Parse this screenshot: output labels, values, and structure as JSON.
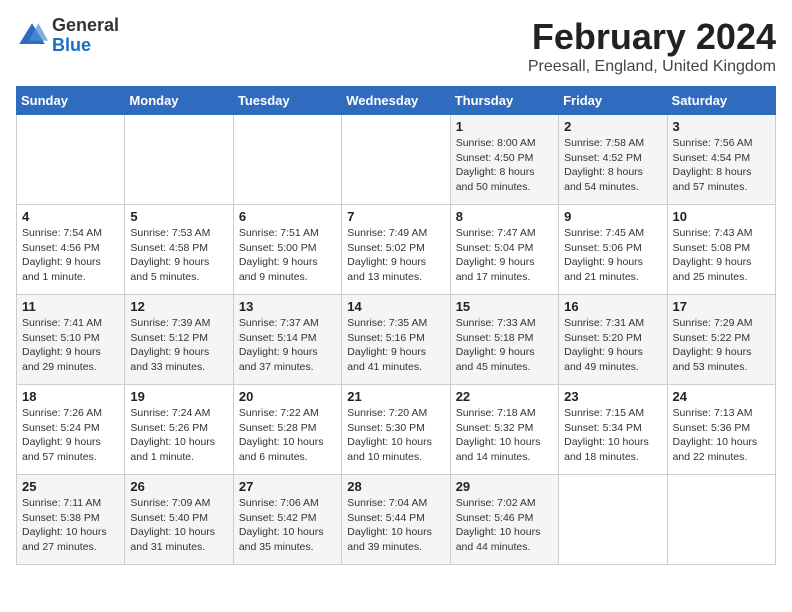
{
  "header": {
    "logo_general": "General",
    "logo_blue": "Blue",
    "title": "February 2024",
    "subtitle": "Preesall, England, United Kingdom"
  },
  "days_of_week": [
    "Sunday",
    "Monday",
    "Tuesday",
    "Wednesday",
    "Thursday",
    "Friday",
    "Saturday"
  ],
  "weeks": [
    [
      {
        "num": "",
        "info": ""
      },
      {
        "num": "",
        "info": ""
      },
      {
        "num": "",
        "info": ""
      },
      {
        "num": "",
        "info": ""
      },
      {
        "num": "1",
        "info": "Sunrise: 8:00 AM\nSunset: 4:50 PM\nDaylight: 8 hours\nand 50 minutes."
      },
      {
        "num": "2",
        "info": "Sunrise: 7:58 AM\nSunset: 4:52 PM\nDaylight: 8 hours\nand 54 minutes."
      },
      {
        "num": "3",
        "info": "Sunrise: 7:56 AM\nSunset: 4:54 PM\nDaylight: 8 hours\nand 57 minutes."
      }
    ],
    [
      {
        "num": "4",
        "info": "Sunrise: 7:54 AM\nSunset: 4:56 PM\nDaylight: 9 hours\nand 1 minute."
      },
      {
        "num": "5",
        "info": "Sunrise: 7:53 AM\nSunset: 4:58 PM\nDaylight: 9 hours\nand 5 minutes."
      },
      {
        "num": "6",
        "info": "Sunrise: 7:51 AM\nSunset: 5:00 PM\nDaylight: 9 hours\nand 9 minutes."
      },
      {
        "num": "7",
        "info": "Sunrise: 7:49 AM\nSunset: 5:02 PM\nDaylight: 9 hours\nand 13 minutes."
      },
      {
        "num": "8",
        "info": "Sunrise: 7:47 AM\nSunset: 5:04 PM\nDaylight: 9 hours\nand 17 minutes."
      },
      {
        "num": "9",
        "info": "Sunrise: 7:45 AM\nSunset: 5:06 PM\nDaylight: 9 hours\nand 21 minutes."
      },
      {
        "num": "10",
        "info": "Sunrise: 7:43 AM\nSunset: 5:08 PM\nDaylight: 9 hours\nand 25 minutes."
      }
    ],
    [
      {
        "num": "11",
        "info": "Sunrise: 7:41 AM\nSunset: 5:10 PM\nDaylight: 9 hours\nand 29 minutes."
      },
      {
        "num": "12",
        "info": "Sunrise: 7:39 AM\nSunset: 5:12 PM\nDaylight: 9 hours\nand 33 minutes."
      },
      {
        "num": "13",
        "info": "Sunrise: 7:37 AM\nSunset: 5:14 PM\nDaylight: 9 hours\nand 37 minutes."
      },
      {
        "num": "14",
        "info": "Sunrise: 7:35 AM\nSunset: 5:16 PM\nDaylight: 9 hours\nand 41 minutes."
      },
      {
        "num": "15",
        "info": "Sunrise: 7:33 AM\nSunset: 5:18 PM\nDaylight: 9 hours\nand 45 minutes."
      },
      {
        "num": "16",
        "info": "Sunrise: 7:31 AM\nSunset: 5:20 PM\nDaylight: 9 hours\nand 49 minutes."
      },
      {
        "num": "17",
        "info": "Sunrise: 7:29 AM\nSunset: 5:22 PM\nDaylight: 9 hours\nand 53 minutes."
      }
    ],
    [
      {
        "num": "18",
        "info": "Sunrise: 7:26 AM\nSunset: 5:24 PM\nDaylight: 9 hours\nand 57 minutes."
      },
      {
        "num": "19",
        "info": "Sunrise: 7:24 AM\nSunset: 5:26 PM\nDaylight: 10 hours\nand 1 minute."
      },
      {
        "num": "20",
        "info": "Sunrise: 7:22 AM\nSunset: 5:28 PM\nDaylight: 10 hours\nand 6 minutes."
      },
      {
        "num": "21",
        "info": "Sunrise: 7:20 AM\nSunset: 5:30 PM\nDaylight: 10 hours\nand 10 minutes."
      },
      {
        "num": "22",
        "info": "Sunrise: 7:18 AM\nSunset: 5:32 PM\nDaylight: 10 hours\nand 14 minutes."
      },
      {
        "num": "23",
        "info": "Sunrise: 7:15 AM\nSunset: 5:34 PM\nDaylight: 10 hours\nand 18 minutes."
      },
      {
        "num": "24",
        "info": "Sunrise: 7:13 AM\nSunset: 5:36 PM\nDaylight: 10 hours\nand 22 minutes."
      }
    ],
    [
      {
        "num": "25",
        "info": "Sunrise: 7:11 AM\nSunset: 5:38 PM\nDaylight: 10 hours\nand 27 minutes."
      },
      {
        "num": "26",
        "info": "Sunrise: 7:09 AM\nSunset: 5:40 PM\nDaylight: 10 hours\nand 31 minutes."
      },
      {
        "num": "27",
        "info": "Sunrise: 7:06 AM\nSunset: 5:42 PM\nDaylight: 10 hours\nand 35 minutes."
      },
      {
        "num": "28",
        "info": "Sunrise: 7:04 AM\nSunset: 5:44 PM\nDaylight: 10 hours\nand 39 minutes."
      },
      {
        "num": "29",
        "info": "Sunrise: 7:02 AM\nSunset: 5:46 PM\nDaylight: 10 hours\nand 44 minutes."
      },
      {
        "num": "",
        "info": ""
      },
      {
        "num": "",
        "info": ""
      }
    ]
  ]
}
